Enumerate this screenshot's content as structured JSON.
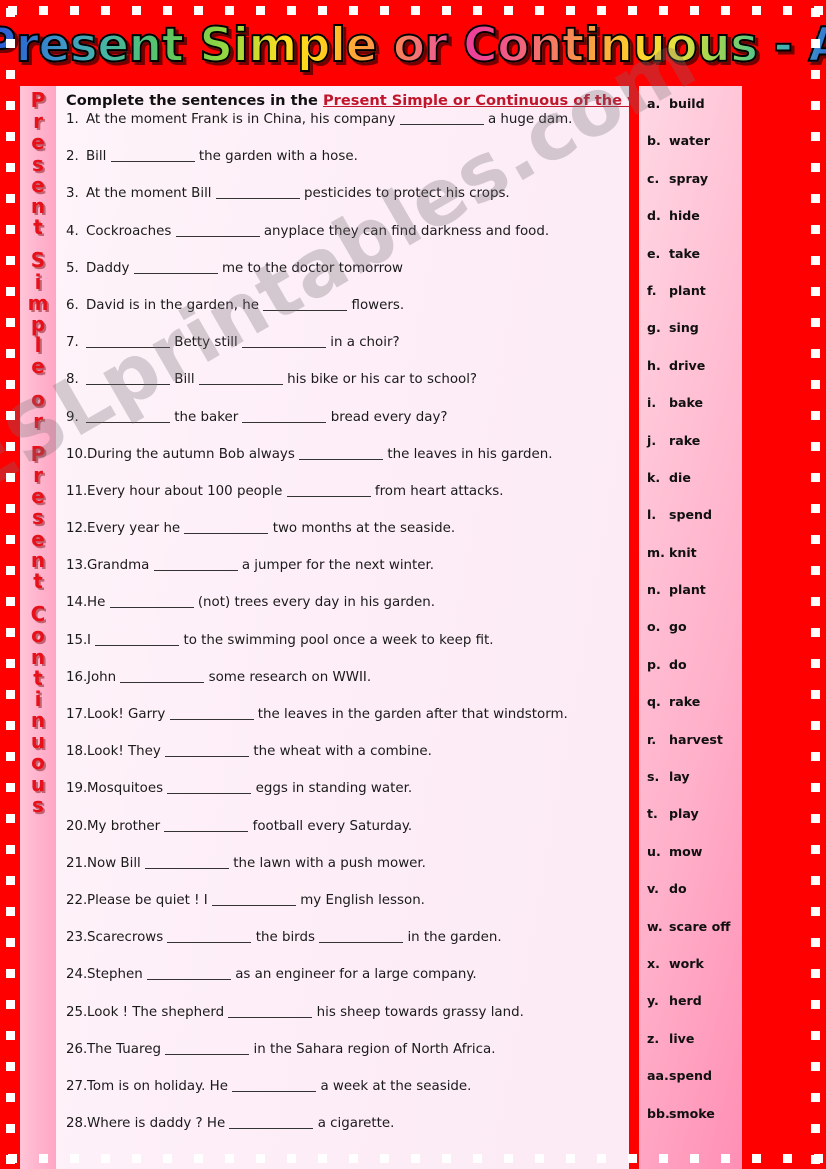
{
  "title": "Present Simple or Continuous - A",
  "sidebar_vertical_text": "Present Simple or Present Continuous",
  "watermark": "ESLprintables.com",
  "colors": {
    "border_red": "#fe0000",
    "highlight_red": "#c0152b",
    "sidebar_letter_red": "#e8111a",
    "panel_pink": "#fff4fa",
    "verbs_pink": "#ffc3d6"
  },
  "instruction": {
    "lead": "Complete the sentences in the ",
    "highlight": "Present Simple or Continuous of the verbs",
    "tail": "."
  },
  "questions": [
    {
      "num": "1.",
      "pre": "At the moment Frank is in China,  his company ",
      "post": " a huge dam.",
      "blanks": 1
    },
    {
      "num": "2.",
      "pre": "Bill ",
      "post": " the garden with a hose.",
      "blanks": 1
    },
    {
      "num": "3.",
      "pre": "At the moment Bill ",
      "post": " pesticides to protect his crops.",
      "blanks": 1
    },
    {
      "num": "4.",
      "pre": "Cockroaches ",
      "post": " anyplace they can find darkness and food.",
      "blanks": 1
    },
    {
      "num": "5.",
      "pre": "Daddy ",
      "post": " me to the doctor tomorrow",
      "blanks": 1
    },
    {
      "num": "6.",
      "pre": "David is in the garden, he ",
      "post": " flowers.",
      "blanks": 1
    },
    {
      "num": "7.",
      "pre": "",
      "mid": " Betty still ",
      "post": " in a choir?",
      "blanks": 2
    },
    {
      "num": "8.",
      "pre": "",
      "mid": " Bill ",
      "post": " his bike or his car to school?",
      "blanks": 2
    },
    {
      "num": "9.",
      "pre": "",
      "mid": " the baker ",
      "post": " bread every day?",
      "blanks": 2
    },
    {
      "num": "10.",
      "pre": "During the autumn Bob always ",
      "post": " the leaves in his garden.",
      "blanks": 1
    },
    {
      "num": "11.",
      "pre": "Every hour about 100 people ",
      "post": " from heart attacks.",
      "blanks": 1
    },
    {
      "num": "12.",
      "pre": "Every year he ",
      "post": " two months at the seaside.",
      "blanks": 1
    },
    {
      "num": "13.",
      "pre": "Grandma ",
      "post": " a jumper for the next winter.",
      "blanks": 1
    },
    {
      "num": "14.",
      "pre": "He ",
      "post": " (not) trees every day in his garden.",
      "blanks": 1
    },
    {
      "num": "15.",
      "pre": "I ",
      "post": " to the swimming pool once a week to keep fit.",
      "blanks": 1
    },
    {
      "num": "16.",
      "pre": "John ",
      "post": " some research on WWII.",
      "blanks": 1
    },
    {
      "num": "17.",
      "pre": "Look! Garry ",
      "post": " the leaves in the garden after that windstorm.",
      "blanks": 1
    },
    {
      "num": "18.",
      "pre": "Look! They ",
      "post": " the wheat with a combine.",
      "blanks": 1
    },
    {
      "num": "19.",
      "pre": "Mosquitoes ",
      "post": " eggs in standing water.",
      "blanks": 1
    },
    {
      "num": "20.",
      "pre": "My brother ",
      "post": " football every Saturday.",
      "blanks": 1
    },
    {
      "num": "21.",
      "pre": "Now Bill ",
      "post": " the lawn with a push mower.",
      "blanks": 1
    },
    {
      "num": "22.",
      "pre": "Please be quiet ! I ",
      "post": " my English lesson.",
      "blanks": 1
    },
    {
      "num": "23.",
      "pre": "Scarecrows ",
      "mid": " the birds ",
      "post": " in the garden.",
      "blanks": 2
    },
    {
      "num": "24.",
      "pre": "Stephen ",
      "post": " as an engineer for a large company.",
      "blanks": 1
    },
    {
      "num": "25.",
      "pre": "Look ! The shepherd ",
      "post": " his sheep towards grassy land.",
      "blanks": 1
    },
    {
      "num": "26.",
      "pre": "The Tuareg ",
      "post": " in the Sahara region of North Africa.",
      "blanks": 1
    },
    {
      "num": "27.",
      "pre": "Tom is on holiday. He ",
      "post": " a week at the seaside.",
      "blanks": 1
    },
    {
      "num": "28.",
      "pre": "Where is daddy ? He ",
      "post": " a cigarette.",
      "blanks": 1
    }
  ],
  "verbs": [
    {
      "key": "a.",
      "verb": "build"
    },
    {
      "key": "b.",
      "verb": "water"
    },
    {
      "key": "c.",
      "verb": "spray"
    },
    {
      "key": "d.",
      "verb": "hide"
    },
    {
      "key": "e.",
      "verb": "take"
    },
    {
      "key": "f.",
      "verb": "plant"
    },
    {
      "key": "g.",
      "verb": "sing"
    },
    {
      "key": "h.",
      "verb": "drive"
    },
    {
      "key": "i.",
      "verb": "bake"
    },
    {
      "key": "j.",
      "verb": "rake"
    },
    {
      "key": "k.",
      "verb": "die"
    },
    {
      "key": "l.",
      "verb": "spend"
    },
    {
      "key": "m.",
      "verb": "knit"
    },
    {
      "key": "n.",
      "verb": "plant"
    },
    {
      "key": "o.",
      "verb": "go"
    },
    {
      "key": "p.",
      "verb": "do"
    },
    {
      "key": "q.",
      "verb": "rake"
    },
    {
      "key": "r.",
      "verb": "harvest"
    },
    {
      "key": "s.",
      "verb": "lay"
    },
    {
      "key": "t.",
      "verb": "play"
    },
    {
      "key": "u.",
      "verb": "mow"
    },
    {
      "key": "v.",
      "verb": "do"
    },
    {
      "key": "w.",
      "verb": "scare off"
    },
    {
      "key": "x.",
      "verb": "work"
    },
    {
      "key": "y.",
      "verb": "herd"
    },
    {
      "key": "z.",
      "verb": "live"
    },
    {
      "key": "aa.",
      "verb": "spend"
    },
    {
      "key": "bb.",
      "verb": "smoke"
    }
  ]
}
